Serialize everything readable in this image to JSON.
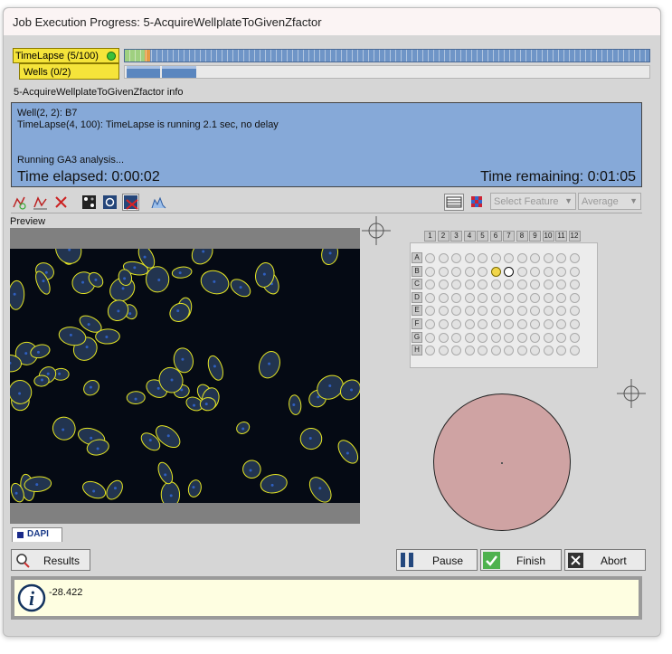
{
  "window": {
    "title": "Job Execution Progress: 5-AcquireWellplateToGivenZfactor"
  },
  "loops": {
    "timelapse": "TimeLapse (5/100)",
    "wells": "Wells (0/2)"
  },
  "info": {
    "section_label": "5-AcquireWellplateToGivenZfactor info",
    "line1": "Well(2, 2): B7",
    "line2": "TimeLapse(4, 100): TimeLapse is running 2.1 sec, no delay",
    "line3": "Running GA3 analysis...",
    "elapsed": "Time elapsed: 0:00:02",
    "remaining": "Time remaining: 0:01:05"
  },
  "toolbar": {
    "feature_placeholder": "Select Feature",
    "aggregate": "Average"
  },
  "preview": {
    "label": "Preview",
    "channel_tab": "DAPI"
  },
  "plate": {
    "columns": [
      "1",
      "2",
      "3",
      "4",
      "5",
      "6",
      "7",
      "8",
      "9",
      "10",
      "11",
      "12"
    ],
    "rows": [
      "A",
      "B",
      "C",
      "D",
      "E",
      "F",
      "G",
      "H"
    ],
    "current_well": "B6",
    "next_well": "B7"
  },
  "buttons": {
    "results": "Results",
    "pause": "Pause",
    "finish": "Finish",
    "abort": "Abort"
  },
  "message": {
    "text": "-28.422"
  },
  "colors": {
    "progress_bar": "#6f95c7",
    "info_bg": "#86a9d8",
    "loop_bg": "#f5e43a",
    "well_dish": "#cfa3a3",
    "message_bg": "#fefee1"
  }
}
